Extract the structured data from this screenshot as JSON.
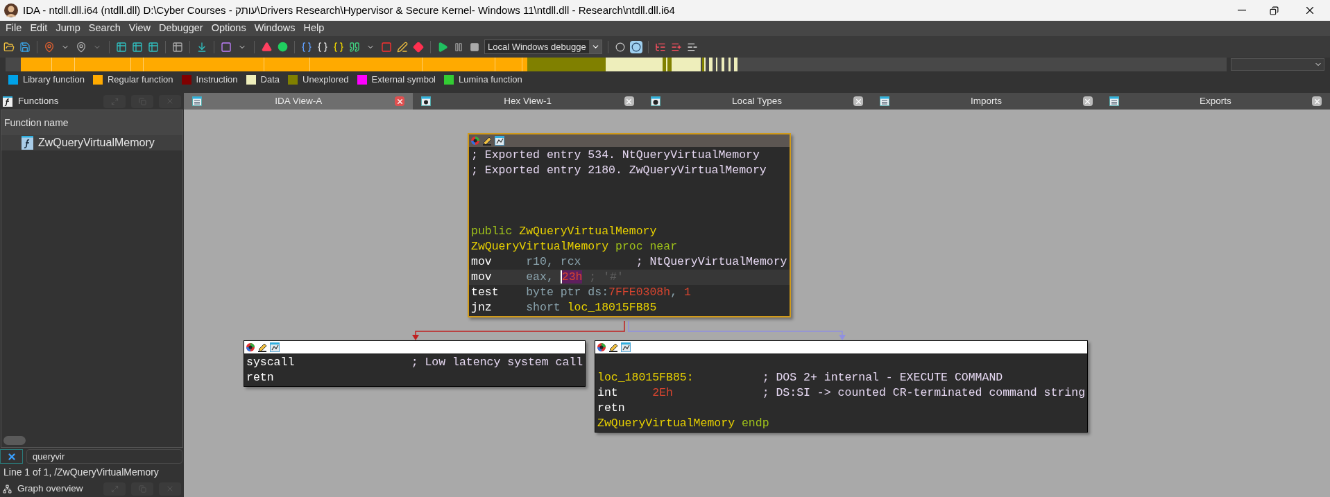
{
  "window": {
    "title": "IDA - ntdll.dll.i64 (ntdll.dll) D:\\Cyber Courses - עותק\\Drivers Research\\Hypervisor & Secure Kernel- Windows 11\\ntdll.dll - Research\\ntdll.dll.i64"
  },
  "menu": [
    "File",
    "Edit",
    "Jump",
    "Search",
    "View",
    "Debugger",
    "Options",
    "Windows",
    "Help"
  ],
  "toolbar": {
    "debugger_select": {
      "value": "Local Windows debugge"
    }
  },
  "legend": [
    {
      "label": "Library function",
      "color": "#00a2e8"
    },
    {
      "label": "Regular function",
      "color": "#ffaa00"
    },
    {
      "label": "Instruction",
      "color": "#800000"
    },
    {
      "label": "Data",
      "color": "#eeeebb"
    },
    {
      "label": "Unexplored",
      "color": "#808000"
    },
    {
      "label": "External symbol",
      "color": "#ff00ff"
    },
    {
      "label": "Lumina function",
      "color": "#33cc33"
    }
  ],
  "functions_panel": {
    "title": "Functions",
    "column": "Function name",
    "rows": [
      {
        "name": "ZwQueryVirtualMemory",
        "selected": true
      }
    ],
    "filter": {
      "value": "queryvir"
    },
    "status": "Line 1 of 1, /ZwQueryVirtualMemory",
    "graph_overview_title": "Graph overview"
  },
  "tabs": [
    {
      "label": "IDA View-A",
      "selected": true
    },
    {
      "label": "Hex View-1",
      "selected": false
    },
    {
      "label": "Local Types",
      "selected": false
    },
    {
      "label": "Imports",
      "selected": false
    },
    {
      "label": "Exports",
      "selected": false
    }
  ],
  "graph": {
    "nodes": [
      {
        "selected": true,
        "lines": [
          {
            "kind": "code",
            "current": false,
            "segments": [
              {
                "text": "; Exported entry 534. NtQueryVirtualMemory",
                "kind": "comment"
              }
            ]
          },
          {
            "kind": "code",
            "current": false,
            "segments": [
              {
                "text": "; Exported entry 2180. ZwQueryVirtualMemory",
                "kind": "comment"
              }
            ]
          },
          {
            "kind": "blank"
          },
          {
            "kind": "blank"
          },
          {
            "kind": "blank"
          },
          {
            "kind": "code",
            "current": false,
            "segments": [
              {
                "text": "public ",
                "kind": "keyword"
              },
              {
                "text": "ZwQueryVirtualMemory",
                "kind": "name"
              }
            ]
          },
          {
            "kind": "code",
            "current": false,
            "segments": [
              {
                "text": "ZwQueryVirtualMemory",
                "kind": "name"
              },
              {
                "text": " proc near",
                "kind": "keyword"
              }
            ]
          },
          {
            "kind": "code",
            "current": false,
            "segments": [
              {
                "text": "mov     ",
                "kind": "mnemonic"
              },
              {
                "text": "r10, rcx",
                "kind": "operand"
              },
              {
                "text": "        ; NtQueryVirtualMemory",
                "kind": "comment"
              }
            ]
          },
          {
            "kind": "code",
            "current": true,
            "segments": [
              {
                "text": "mov     ",
                "kind": "mnemonic"
              },
              {
                "text": "eax, ",
                "kind": "operand"
              },
              {
                "text": "23h",
                "kind": "highlighted"
              },
              {
                "text": " ; '#'",
                "kind": "dim"
              }
            ]
          },
          {
            "kind": "code",
            "current": false,
            "segments": [
              {
                "text": "test    ",
                "kind": "mnemonic"
              },
              {
                "text": "byte ptr ds:",
                "kind": "operand"
              },
              {
                "text": "7FFE0308h",
                "kind": "number"
              },
              {
                "text": ", ",
                "kind": "operand"
              },
              {
                "text": "1",
                "kind": "number"
              }
            ]
          },
          {
            "kind": "code",
            "current": false,
            "segments": [
              {
                "text": "jnz     ",
                "kind": "mnemonic"
              },
              {
                "text": "short ",
                "kind": "operand"
              },
              {
                "text": "loc_18015FB85",
                "kind": "name"
              }
            ]
          }
        ]
      },
      {
        "selected": false,
        "lines": [
          {
            "kind": "code",
            "current": false,
            "segments": [
              {
                "text": "syscall                 ",
                "kind": "mnemonic"
              },
              {
                "text": "; Low latency system call",
                "kind": "comment"
              }
            ]
          },
          {
            "kind": "code",
            "current": false,
            "segments": [
              {
                "text": "retn",
                "kind": "mnemonic"
              }
            ]
          }
        ]
      },
      {
        "selected": false,
        "lines": [
          {
            "kind": "blank"
          },
          {
            "kind": "code",
            "current": false,
            "segments": [
              {
                "text": "loc_18015FB85:          ",
                "kind": "name"
              },
              {
                "text": "; DOS 2+ internal - EXECUTE COMMAND",
                "kind": "comment"
              }
            ]
          },
          {
            "kind": "code",
            "current": false,
            "segments": [
              {
                "text": "int     ",
                "kind": "mnemonic"
              },
              {
                "text": "2Eh",
                "kind": "number"
              },
              {
                "text": "             ; DS:SI -> counted CR-terminated command string",
                "kind": "comment"
              }
            ]
          },
          {
            "kind": "code",
            "current": false,
            "segments": [
              {
                "text": "retn",
                "kind": "mnemonic"
              }
            ]
          },
          {
            "kind": "code",
            "current": false,
            "segments": [
              {
                "text": "ZwQueryVirtualMemory",
                "kind": "name"
              },
              {
                "text": " endp",
                "kind": "keyword"
              }
            ]
          }
        ]
      }
    ]
  }
}
